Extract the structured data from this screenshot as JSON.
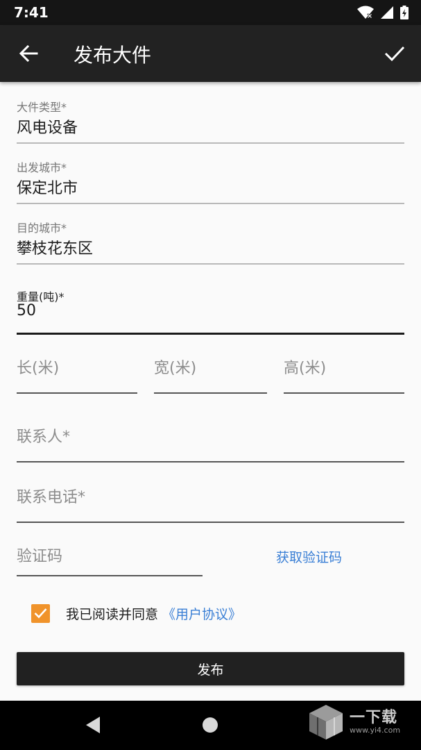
{
  "status": {
    "time": "7:41"
  },
  "header": {
    "title": "发布大件"
  },
  "form": {
    "type_label": "大件类型*",
    "type_value": "风电设备",
    "origin_label": "出发城市*",
    "origin_value": "保定北市",
    "dest_label": "目的城市*",
    "dest_value": "攀枝花东区",
    "weight_label": "重量(吨)*",
    "weight_value": "50",
    "length_hint": "长(米)",
    "width_hint": "宽(米)",
    "height_hint": "高(米)",
    "contact_hint": "联系人*",
    "phone_hint": "联系电话*",
    "code_hint": "验证码",
    "get_code": "获取验证码"
  },
  "agreement": {
    "checked": true,
    "text": "我已阅读并同意",
    "link": "《用户协议》"
  },
  "publish_label": "发布",
  "watermark": {
    "title": "一下载",
    "url": "www.yi4.com"
  },
  "colors": {
    "accent_orange": "#f0932b",
    "link_blue": "#3a7fd5",
    "toolbar": "#222222"
  }
}
